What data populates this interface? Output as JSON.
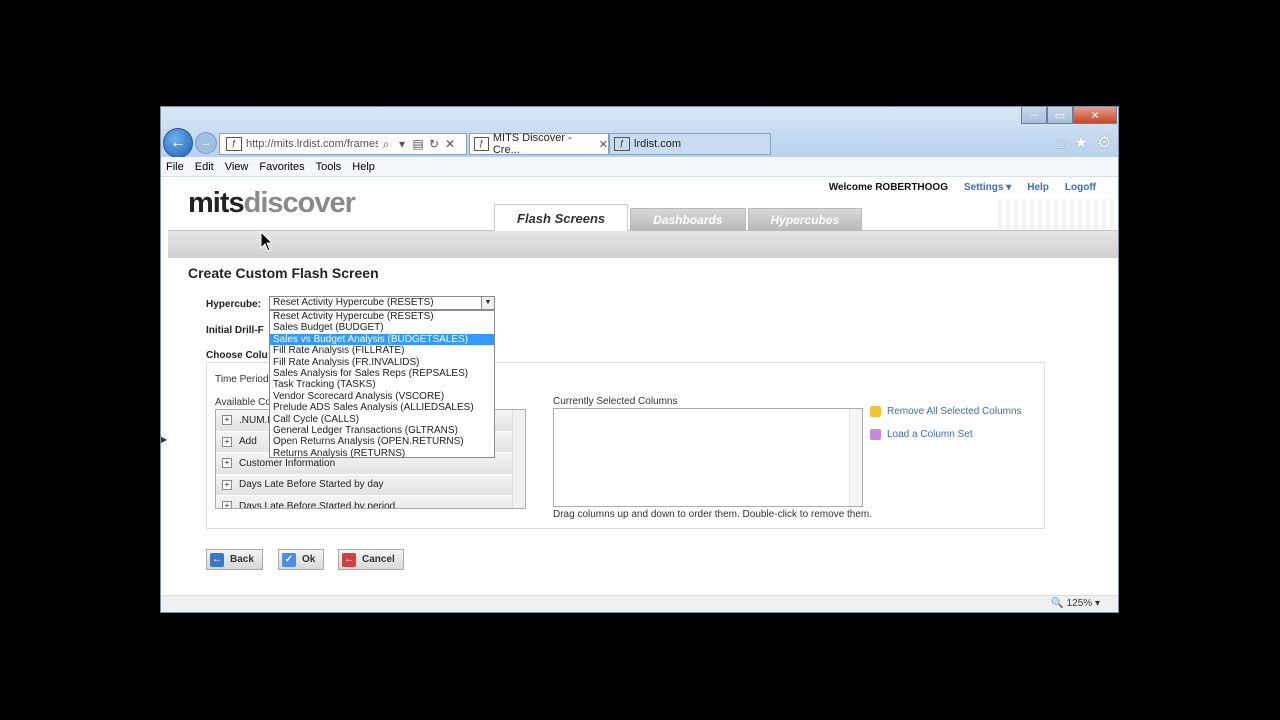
{
  "browser": {
    "address": "http://mits.lrdist.com/frames",
    "tabs": [
      {
        "favicon": "ƒ",
        "label": "MITS Discover - Cre..."
      },
      {
        "favicon": "ƒ",
        "label": "lrdist.com"
      }
    ],
    "menu": [
      "File",
      "Edit",
      "View",
      "Favorites",
      "Tools",
      "Help"
    ],
    "zoom": "125%"
  },
  "app": {
    "logo_a": "mits",
    "logo_b": "discover",
    "welcome": "Welcome ROBERTHOOG",
    "settings": "Settings ▾",
    "help": "Help",
    "logoff": "Logoff",
    "tabs": [
      "Flash Screens",
      "Dashboards",
      "Hypercubes"
    ]
  },
  "form": {
    "title": "Create Custom Flash Screen",
    "hypercube_label": "Hypercube:",
    "selected": "Reset Activity Hypercube (RESETS)",
    "options": [
      "Reset Activity Hypercube (RESETS)",
      "Sales Budget (BUDGET)",
      "Sales vs Budget Analysis (BUDGETSALES)",
      "Fill Rate Analysis (FILLRATE)",
      "Fill Rate Analysis (FR.INVALIDS)",
      "Sales Analysis for Sales Reps (REPSALES)",
      "Task Tracking (TASKS)",
      "Vendor Scorecard Analysis (VSCORE)",
      "Prelude ADS Sales Analysis (ALLIEDSALES)",
      "Call Cycle (CALLS)",
      "General Ledger Transactions (GLTRANS)",
      "Open Returns Analysis (OPEN.RETURNS)",
      "Returns Analysis (RETURNS)"
    ],
    "drill_label": "Initial Drill-F",
    "choose_label": "Choose Colu",
    "time_period": "Time Period",
    "available_label": "Available Co",
    "available_rows": [
      ".NUM.F",
      "Add",
      "Customer Information",
      "Days Late Before Started by day",
      "Days Late Before Started by period"
    ],
    "current_label": "Currently Selected Columns",
    "hint": "Drag columns up and down to order them. Double-click to remove them.",
    "remove_all": "Remove All Selected Columns",
    "load_set": "Load a Column Set",
    "back": "Back",
    "ok": "Ok",
    "cancel": "Cancel"
  }
}
